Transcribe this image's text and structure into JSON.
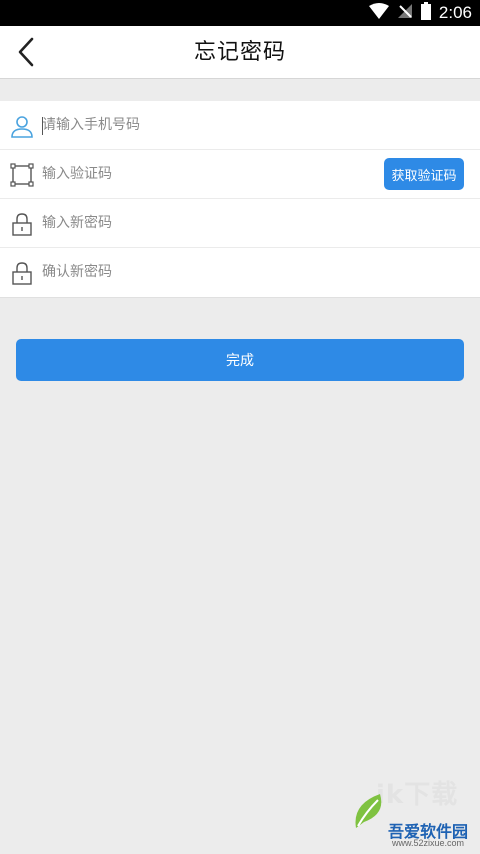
{
  "status_bar": {
    "time": "2:06",
    "icons": [
      "wifi-icon",
      "no-signal-icon",
      "battery-icon"
    ]
  },
  "app_bar": {
    "title": "忘记密码",
    "back_icon": "chevron-left-icon"
  },
  "form": {
    "phone": {
      "icon": "user-icon",
      "placeholder": "请输入手机号码",
      "value": ""
    },
    "code": {
      "icon": "frame-icon",
      "placeholder": "输入验证码",
      "value": "",
      "button_label": "获取验证码"
    },
    "new_password": {
      "icon": "lock-icon",
      "placeholder": "输入新密码",
      "value": ""
    },
    "confirm_password": {
      "icon": "lock-icon",
      "placeholder": "确认新密码",
      "value": ""
    }
  },
  "submit": {
    "label": "完成"
  },
  "watermark": {
    "big_text": "ik下载",
    "name": "吾爱软件园",
    "url": "www.52zixue.com"
  },
  "colors": {
    "accent": "#2e8ae6",
    "user_icon": "#4aa3df",
    "background": "#ececec"
  }
}
